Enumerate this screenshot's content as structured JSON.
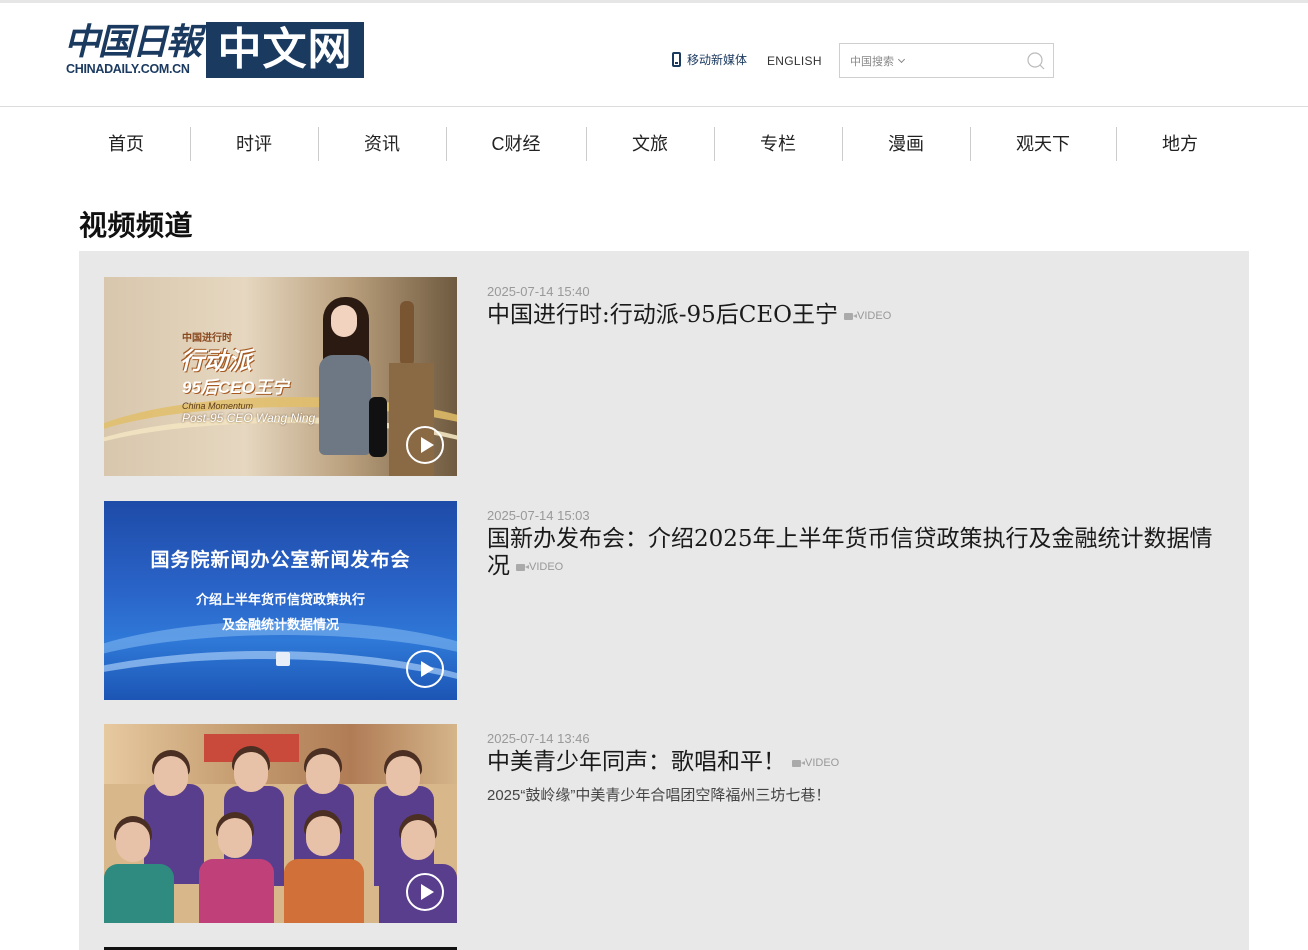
{
  "header": {
    "logo_cn": "中国日報",
    "logo_en": "CHINADAILY.COM.CN",
    "logo_box": "中文网",
    "mobile_link": "移动新媒体",
    "english_link": "ENGLISH",
    "search": {
      "scope": "中国搜索",
      "placeholder": "",
      "value": ""
    }
  },
  "nav": [
    "首页",
    "时评",
    "资讯",
    "C财经",
    "文旅",
    "专栏",
    "漫画",
    "观天下",
    "地方"
  ],
  "page_title": "视频频道",
  "videos": [
    {
      "date": "2025-07-14 15:40",
      "title": "中国进行时:行动派-95后CEO王宁",
      "tag": "VIDEO",
      "desc": "",
      "thumb_text": [
        "中国进行时",
        "行动派",
        "95后CEO王宁",
        "China Momentum",
        "Post-95 CEO Wang Ning"
      ]
    },
    {
      "date": "2025-07-14 15:03",
      "title": "国新办发布会：介绍2025年上半年货币信贷政策执行及金融统计数据情况",
      "tag": "VIDEO",
      "desc": "",
      "thumb_text": [
        "国务院新闻办公室新闻发布会",
        "介绍上半年货币信贷政策执行",
        "及金融统计数据情况"
      ]
    },
    {
      "date": "2025-07-14 13:46",
      "title": "中美青少年同声：歌唱和平！",
      "tag": "VIDEO",
      "desc": "2025“鼓岭缘”中美青少年合唱团空降福州三坊七巷！"
    }
  ],
  "colors": {
    "brand": "#1b3a60",
    "list_bg": "#e8e8e8"
  }
}
